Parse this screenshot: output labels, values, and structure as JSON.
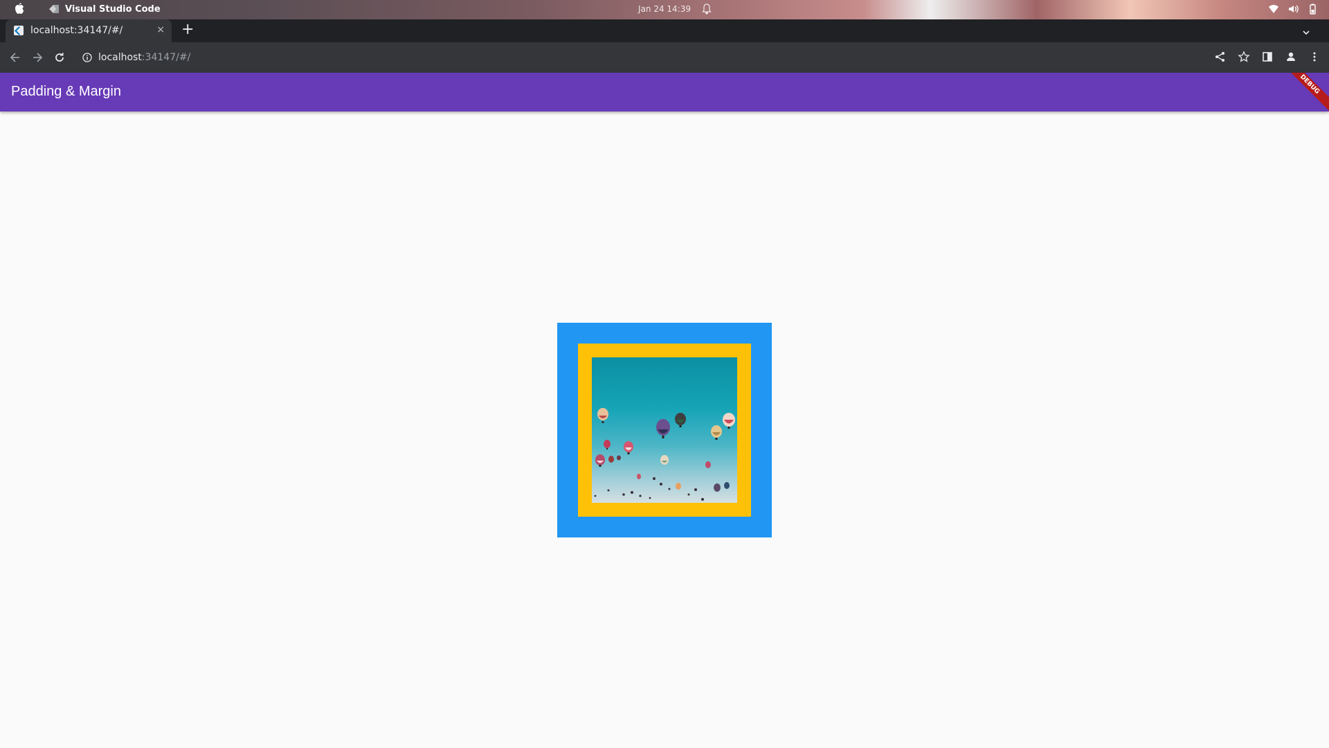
{
  "os": {
    "app_name": "Visual Studio Code",
    "clock": "Jan 24  14:39"
  },
  "browser": {
    "tab_title": "localhost:34147/#/",
    "tab_close": "×",
    "new_tab": "+",
    "url_host": "localhost",
    "url_rest": ":34147/#/"
  },
  "app": {
    "title": "Padding & Margin",
    "debug_label": "DEBUG",
    "colors": {
      "app_bar": "#673ab7",
      "margin": "#2196f3",
      "padding": "#ffc107"
    }
  },
  "icons": {
    "os": [
      "apple-icon",
      "app-icon",
      "bell-icon",
      "wifi-icon",
      "volume-icon",
      "battery-icon"
    ],
    "toolbar": [
      "back-icon",
      "forward-icon",
      "reload-icon",
      "info-icon",
      "share-icon",
      "star-icon",
      "sidepanel-icon",
      "profile-icon",
      "menu-icon"
    ]
  }
}
